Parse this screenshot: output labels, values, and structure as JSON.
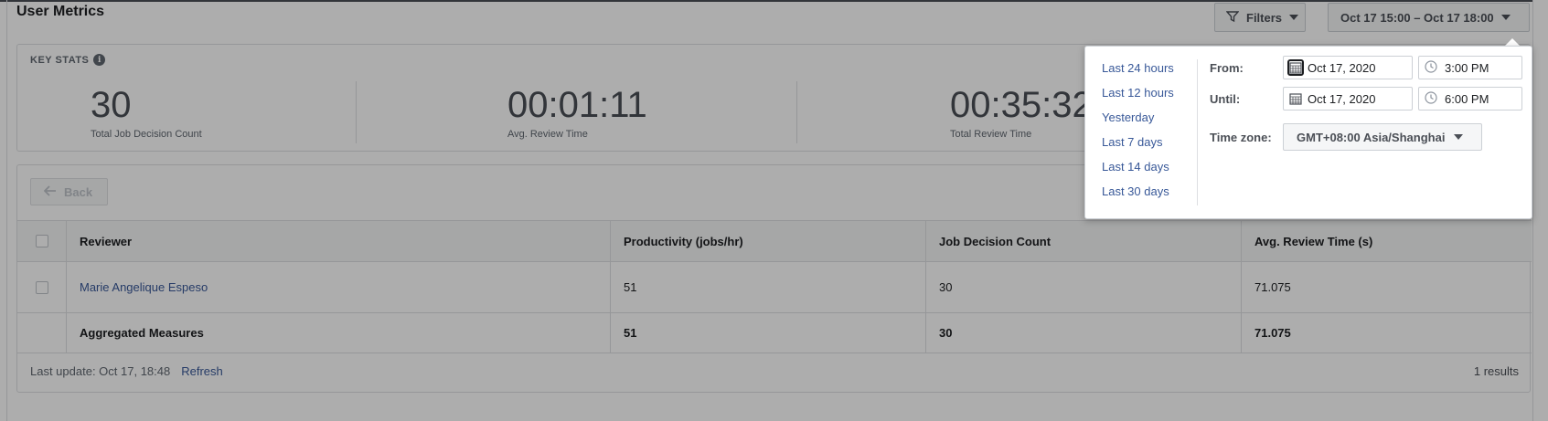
{
  "page": {
    "title": "User Metrics"
  },
  "toolbar": {
    "filters_label": "Filters",
    "date_range_label": "Oct 17 15:00 – Oct 17 18:00"
  },
  "key_stats": {
    "heading": "KEY STATS",
    "stats": [
      {
        "value": "30",
        "label": "Total Job Decision Count"
      },
      {
        "value": "00:01:11",
        "label": "Avg. Review Time"
      },
      {
        "value": "00:35:32",
        "label": "Total Review Time"
      }
    ]
  },
  "table": {
    "back_label": "Back",
    "headers": [
      "Reviewer",
      "Productivity (jobs/hr)",
      "Job Decision Count",
      "Avg. Review Time (s)"
    ],
    "rows": [
      {
        "reviewer": "Marie Angelique Espeso",
        "productivity": "51",
        "job_decision_count": "30",
        "avg_review_time": "71.075"
      }
    ],
    "aggregate": {
      "label": "Aggregated Measures",
      "productivity": "51",
      "job_decision_count": "30",
      "avg_review_time": "71.075"
    },
    "footer": {
      "last_update": "Last update: Oct 17, 18:48",
      "refresh": "Refresh",
      "results": "1 results"
    }
  },
  "date_picker": {
    "presets": [
      "Last 24 hours",
      "Last 12 hours",
      "Yesterday",
      "Last 7 days",
      "Last 14 days",
      "Last 30 days"
    ],
    "from_label": "From:",
    "until_label": "Until:",
    "timezone_label": "Time zone:",
    "from_date": "Oct 17, 2020",
    "from_time": "3:00 PM",
    "until_date": "Oct 17, 2020",
    "until_time": "6:00 PM",
    "timezone": "GMT+08:00 Asia/Shanghai"
  },
  "colors": {
    "link": "#385898",
    "overlay": "rgba(0,0,0,0.32)"
  },
  "icons": [
    "filter-icon",
    "caret-down-icon",
    "info-icon",
    "arrow-left-icon",
    "calendar-icon",
    "clock-icon"
  ]
}
